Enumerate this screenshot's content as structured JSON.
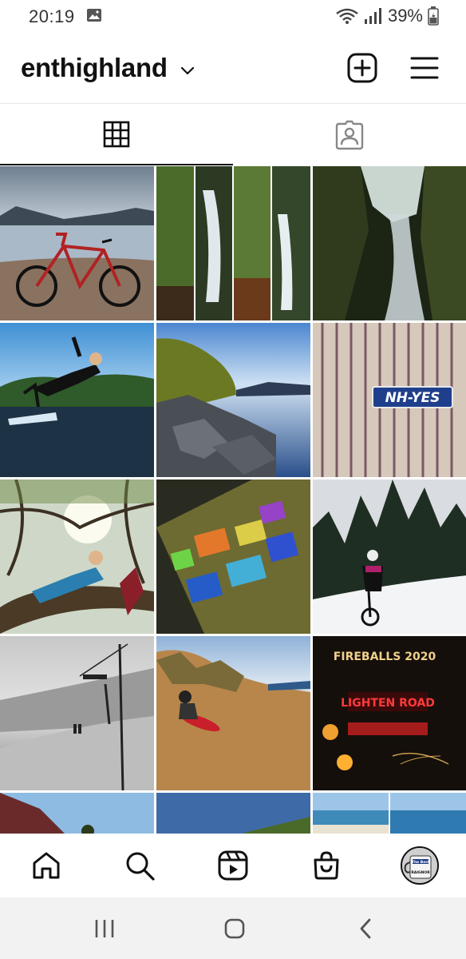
{
  "status_bar": {
    "time": "20:19",
    "battery_percent": "39%",
    "icons": [
      "gallery-icon",
      "wifi-icon",
      "signal-icon",
      "battery-icon"
    ]
  },
  "header": {
    "username": "enthighland",
    "icons": [
      "chevron-down-icon",
      "new-post-icon",
      "menu-icon"
    ]
  },
  "tabs": [
    {
      "name": "grid",
      "icon": "grid-icon",
      "selected": true
    },
    {
      "name": "tagged",
      "icon": "tagged-icon",
      "selected": false
    }
  ],
  "posts": {
    "sign_text": "NH-YES",
    "neon_text": "FIREBALLS 2020",
    "neon_text_2": "LIGHTEN ROAD",
    "mug_text": "The Best",
    "mug_text_2": "RAIGNOR"
  },
  "bottom_nav": {
    "icons": [
      "home-icon",
      "search-icon",
      "reels-icon",
      "shop-icon",
      "profile-avatar"
    ]
  },
  "system_nav": {
    "icons": [
      "recent-apps-icon",
      "home-button-icon",
      "back-icon"
    ]
  },
  "colors": {
    "text": "#111111",
    "divider": "#e6e6e6",
    "system_bar": "#f2f2f2"
  }
}
